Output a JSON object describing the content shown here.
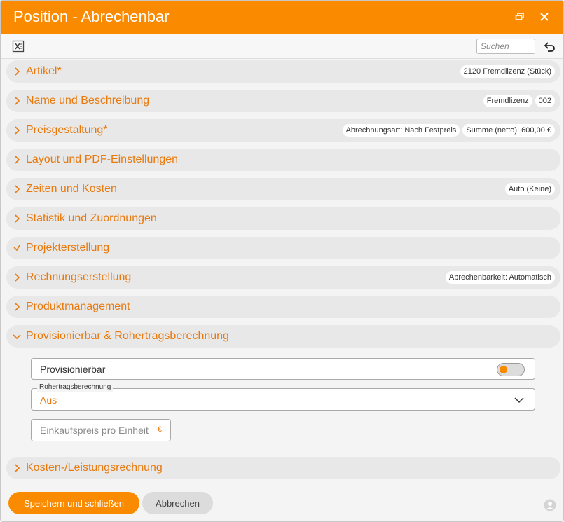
{
  "window": {
    "title": "Position - Abrechenbar",
    "restore_icon": "restore-window-icon",
    "close_icon": "close-icon"
  },
  "toolbar": {
    "excel_icon": "excel-export-icon",
    "search_placeholder": "Suchen",
    "undo_icon": "undo-icon"
  },
  "sections": [
    {
      "label": "Artikel*",
      "state": "collapsed",
      "badges": [
        "2120 Fremdlizenz (Stück)"
      ]
    },
    {
      "label": "Name und Beschreibung",
      "state": "collapsed",
      "badges": [
        "Fremdlizenz",
        "002"
      ]
    },
    {
      "label": "Preisgestaltung*",
      "state": "collapsed",
      "badges": [
        "Abrechnungsart: Nach Festpreis",
        "Summe (netto): 600,00 €"
      ]
    },
    {
      "label": "Layout und PDF-Einstellungen",
      "state": "collapsed",
      "badges": []
    },
    {
      "label": "Zeiten und Kosten",
      "state": "collapsed",
      "badges": [
        "Auto (Keine)"
      ]
    },
    {
      "label": "Statistik und Zuordnungen",
      "state": "collapsed",
      "badges": []
    },
    {
      "label": "Projekterstellung",
      "state": "expanding",
      "badges": []
    },
    {
      "label": "Rechnungserstellung",
      "state": "collapsed",
      "badges": [
        "Abrechenbarkeit: Automatisch"
      ]
    },
    {
      "label": "Produktmanagement",
      "state": "collapsed",
      "badges": []
    },
    {
      "label": "Provisionierbar & Rohertragsberechnung",
      "state": "expanded",
      "badges": []
    },
    {
      "label": "Kosten-/Leistungsrechnung",
      "state": "collapsed",
      "badges": []
    }
  ],
  "provision": {
    "provisionierbar_label": "Provisionierbar",
    "provisionierbar_value": false,
    "rohertrag_legend": "Rohertragsberechnung",
    "rohertrag_value": "Aus",
    "einkaufspreis_placeholder": "Einkaufspreis pro Einheit",
    "currency": "€"
  },
  "footer": {
    "save_label": "Speichern und schließen",
    "cancel_label": "Abbrechen",
    "user_icon": "user-icon"
  },
  "colors": {
    "accent": "#fa8a00",
    "section_label": "#e8790d",
    "section_bg": "#e8e8e8"
  }
}
